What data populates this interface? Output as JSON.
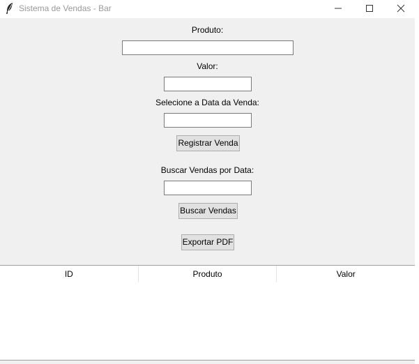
{
  "window": {
    "title": "Sistema de Vendas - Bar",
    "icon": "feather-icon"
  },
  "form": {
    "produto_label": "Produto:",
    "produto_value": "",
    "valor_label": "Valor:",
    "valor_value": "",
    "data_label": "Selecione a Data da Venda:",
    "data_value": "",
    "registrar_button": "Registrar Venda",
    "buscar_label": "Buscar Vendas por Data:",
    "buscar_value": "",
    "buscar_button": "Buscar Vendas",
    "exportar_button": "Exportar PDF"
  },
  "table": {
    "columns": [
      "ID",
      "Produto",
      "Valor"
    ],
    "rows": []
  }
}
